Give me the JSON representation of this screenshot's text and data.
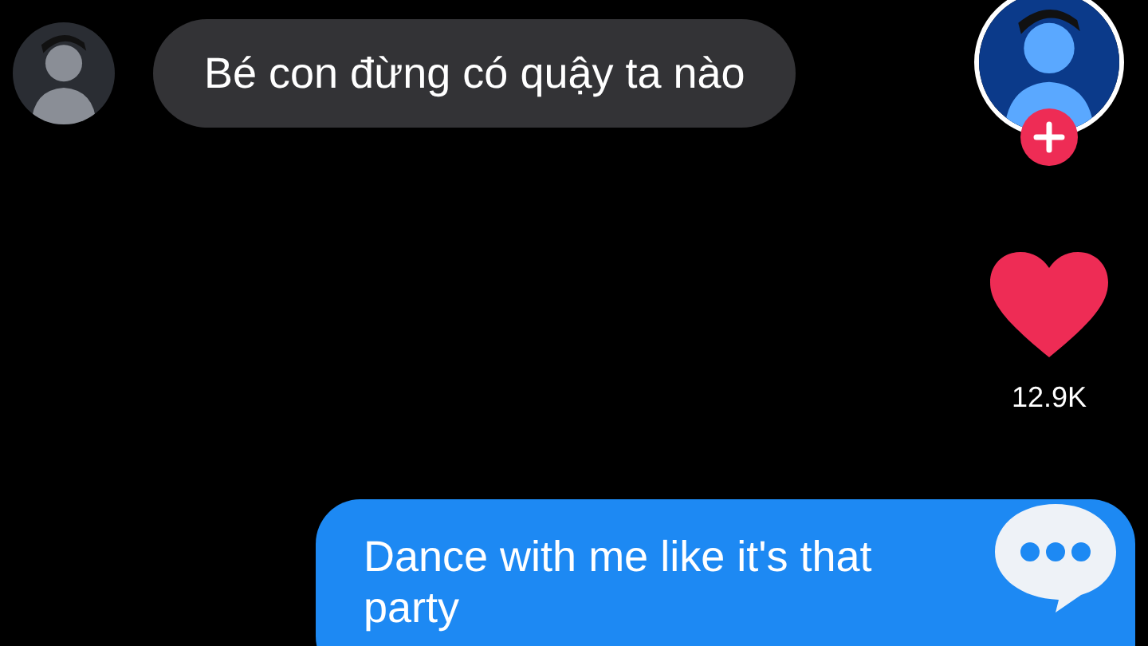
{
  "messages": [
    {
      "kind": "incoming",
      "text": "Bé con đừng có quậy ta nào"
    },
    {
      "kind": "outgoing",
      "text": "Dance with me like it's that party"
    }
  ],
  "side_rail": {
    "like": {
      "liked": true,
      "count": "12.9K"
    }
  }
}
